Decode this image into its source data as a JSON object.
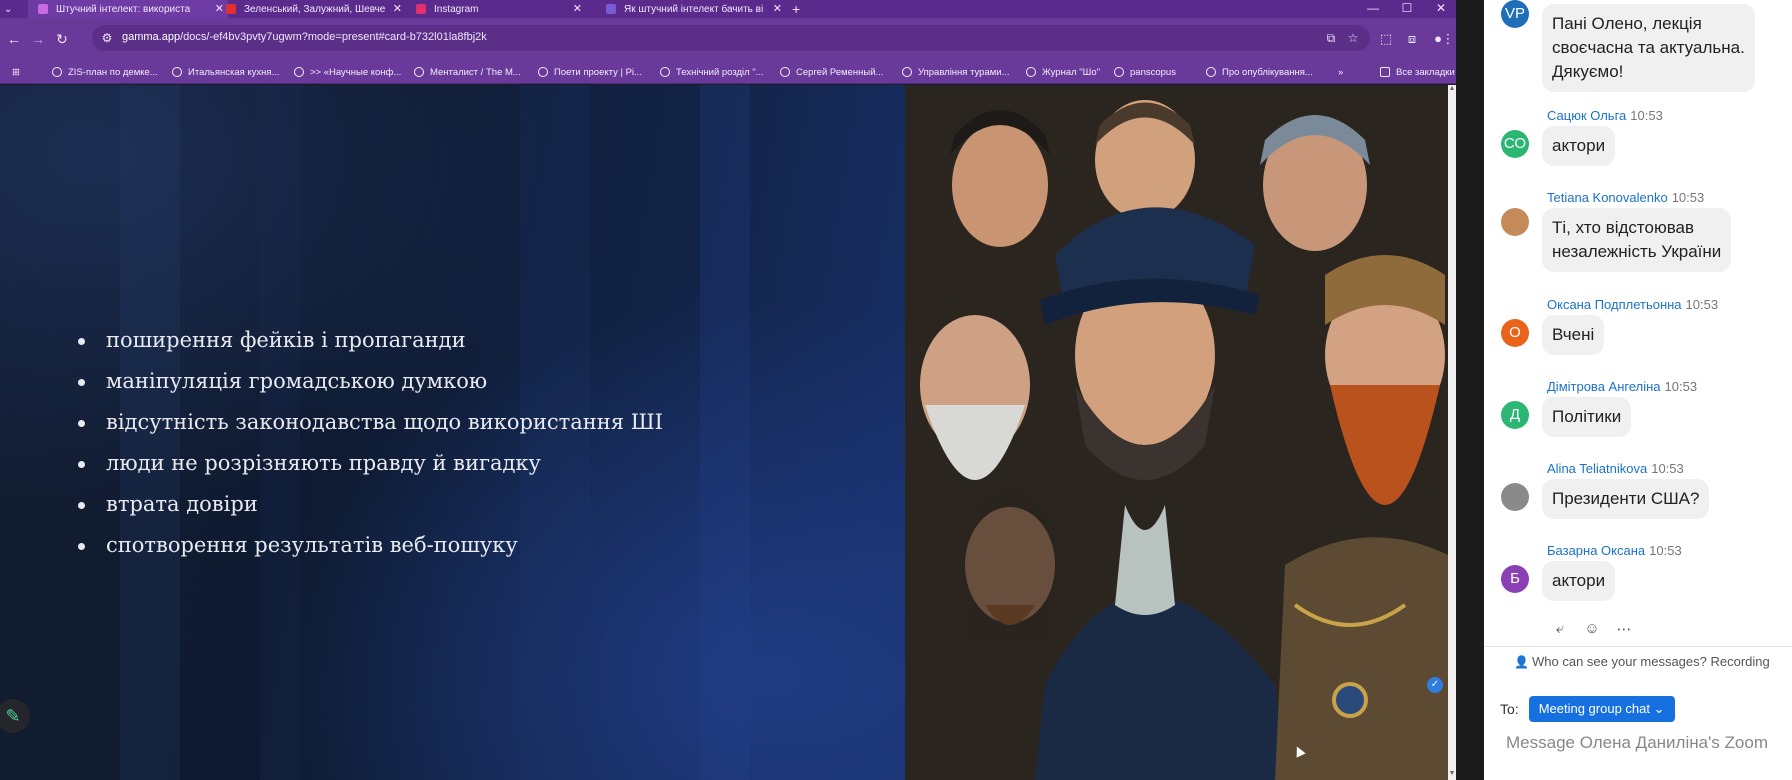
{
  "browser": {
    "tabs": [
      {
        "label": "Штучний інтелект: використа",
        "color": "#c86be0",
        "active": true
      },
      {
        "label": "Зеленський, Залужний, Шевче",
        "color": "#e03030",
        "active": false
      },
      {
        "label": "Instagram",
        "color": "#e1306c",
        "active": false
      },
      {
        "label": "Як штучний інтелект бачить ві",
        "color": "#7a5bd6",
        "active": false
      }
    ],
    "new_tab": "+",
    "window_controls": {
      "minimize": "—",
      "maximize": "☐",
      "close": "✕"
    },
    "url": {
      "host": "gamma.app",
      "path": "/docs/-ef4bv3pvty7ugwm?mode=present#card-b732l01la8fbj2k"
    },
    "bookmarks": [
      "ZIS-план по демке...",
      "Итальянская кухня...",
      ">> «Научные конф...",
      "Менталист / The M...",
      "Поети проекту | Рі...",
      "Технічний розділ \"...",
      "Сергей Ременный...",
      "Управління турами...",
      "Журнал \"Шо\"",
      "panscopus",
      "Про опублікування...",
      "Все закладки"
    ],
    "bookmarks_more": "»"
  },
  "slide": {
    "bullets": [
      "поширення фейків і пропаганди",
      "маніпуляція громадською думкою",
      "відсутність законодавства щодо використання ШІ",
      "люди не розрізняють правду й вигадку",
      "втрата довіри",
      "спотворення результатів веб-пошуку"
    ]
  },
  "chat": {
    "messages": [
      {
        "avatar": "VP",
        "avatar_color": "#1f6fb8",
        "sender": "",
        "time": "",
        "text_lines": [
          "Пані Олено, лекція",
          "своєчасна та актуальна.",
          "Дякуємо!"
        ]
      },
      {
        "avatar": "СО",
        "avatar_color": "#2bb673",
        "sender": "Сацюк Ольга",
        "time": "10:53",
        "text_lines": [
          "актори"
        ]
      },
      {
        "avatar": "",
        "avatar_color": "#c48a5a",
        "sender": "Tetiana Konovalenko",
        "time": "10:53",
        "text_lines": [
          "Ті, хто відстоював",
          "незалежність України"
        ]
      },
      {
        "avatar": "О",
        "avatar_color": "#e8641b",
        "sender": "Оксана Подплетьонна",
        "time": "10:53",
        "text_lines": [
          "Вчені"
        ]
      },
      {
        "avatar": "Д",
        "avatar_color": "#2bb673",
        "sender": "Дімітрова Ангеліна",
        "time": "10:53",
        "text_lines": [
          "Політики"
        ]
      },
      {
        "avatar": "",
        "avatar_color": "#8a8a8a",
        "sender": "Alina Teliatnikova",
        "time": "10:53",
        "text_lines": [
          "Президенти США?"
        ]
      },
      {
        "avatar": "Б",
        "avatar_color": "#8a3fb5",
        "sender": "Базарна Оксана",
        "time": "10:53",
        "text_lines": [
          "актори"
        ]
      }
    ],
    "visibility_text": "Who can see your messages? Recording",
    "to_label": "To:",
    "recipient": "Meeting group chat",
    "compose_placeholder": "Message Олена Даниліна's Zoom"
  }
}
